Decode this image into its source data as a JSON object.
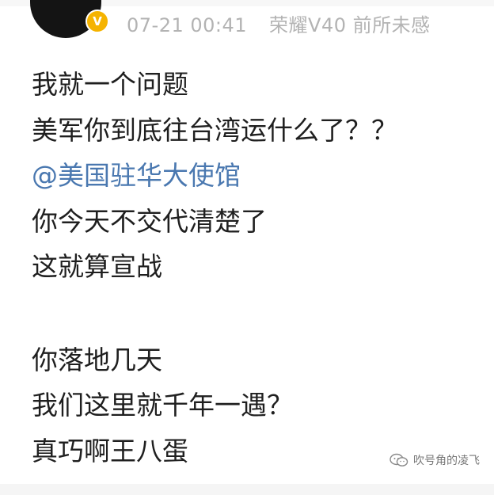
{
  "post": {
    "timestamp": "07-21 00:41",
    "device": "荣耀V40 前所未感",
    "verified_badge": "V",
    "lines": [
      "我就一个问题",
      "美军你到底往台湾运什么了？？",
      "@美国驻华大使馆",
      "你今天不交代清楚了",
      "这就算宣战",
      "",
      "你落地几天",
      "我们这里就千年一遇？",
      "真巧啊王八蛋"
    ]
  },
  "watermark": {
    "text": "吹号角的凌飞",
    "icon": "wechat-icon"
  },
  "colors": {
    "mention": "#4a78b0",
    "meta": "#b3b3b3",
    "badge": "#f5b300"
  }
}
